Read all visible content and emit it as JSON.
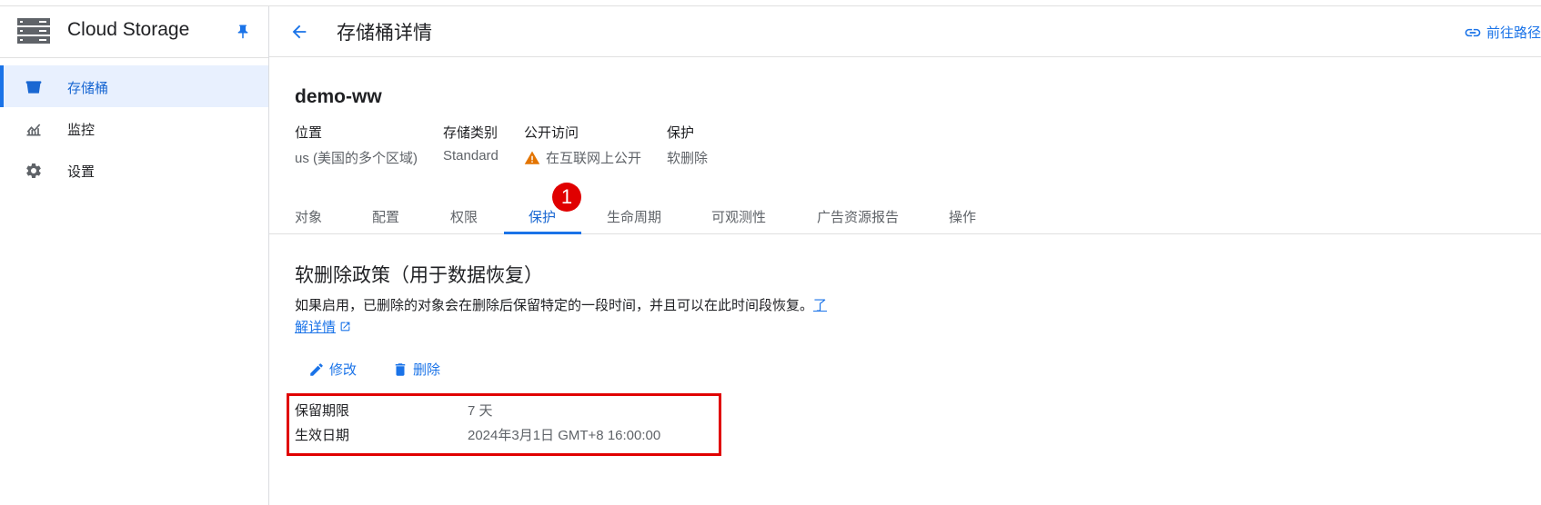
{
  "app": {
    "title": "Cloud Storage"
  },
  "sidebar": {
    "items": [
      {
        "label": "存储桶",
        "icon": "bucket-icon",
        "active": true
      },
      {
        "label": "监控",
        "icon": "monitoring-icon",
        "active": false
      },
      {
        "label": "设置",
        "icon": "gear-icon",
        "active": false
      }
    ]
  },
  "header": {
    "title": "存储桶详情",
    "link_label": "前往路径"
  },
  "bucket": {
    "name": "demo-ww",
    "meta": [
      {
        "label": "位置",
        "value": "us (美国的多个区域)"
      },
      {
        "label": "存储类别",
        "value": "Standard"
      },
      {
        "label": "公开访问",
        "value": "在互联网上公开",
        "icon": "warning-icon"
      },
      {
        "label": "保护",
        "value": "软删除"
      }
    ]
  },
  "tabs": [
    "对象",
    "配置",
    "权限",
    "保护",
    "生命周期",
    "可观测性",
    "广告资源报告",
    "操作"
  ],
  "active_tab": "保护",
  "annotation_badge": "1",
  "policy": {
    "title": "软删除政策（用于数据恢复）",
    "description": "如果启用，已删除的对象会在删除后保留特定的一段时间，并且可以在此时间段恢复。",
    "learn_more_part1": "了",
    "learn_more_part2": "解详情",
    "edit_label": "修改",
    "delete_label": "删除",
    "fields": [
      {
        "label": "保留期限",
        "value": "7 天"
      },
      {
        "label": "生效日期",
        "value": "2024年3月1日 GMT+8 16:00:00"
      }
    ]
  },
  "colors": {
    "accent": "#1a73e8",
    "annotation_red": "#e00000",
    "warning": "#e37400"
  }
}
